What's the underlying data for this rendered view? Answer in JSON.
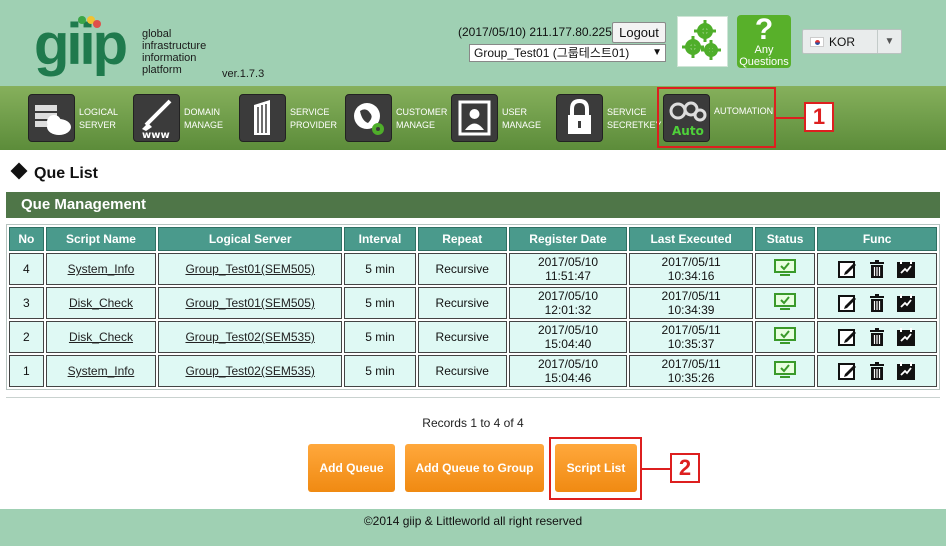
{
  "header": {
    "logo_text": "giip",
    "tagline": [
      "global",
      "infrastructure",
      "information",
      "platform"
    ],
    "version": "ver.1.7.3",
    "datetime_ip": "(2017/05/10) 211.177.80.225",
    "logout_label": "Logout",
    "group_selected": "Group_Test01 (그룹테스트01)",
    "any_questions": [
      "Any",
      "Questions"
    ],
    "language": "KOR"
  },
  "nav": [
    {
      "line1": "LOGICAL",
      "line2": "SERVER",
      "icon": "server-cloud-icon"
    },
    {
      "line1": "DOMAIN",
      "line2": "MANAGE",
      "icon": "www-brush-icon"
    },
    {
      "line1": "SERVICE",
      "line2": "PROVIDER",
      "icon": "building-icon"
    },
    {
      "line1": "CUSTOMER",
      "line2": "MANAGE",
      "icon": "globe-gear-icon"
    },
    {
      "line1": "USER",
      "line2": "MANAGE",
      "icon": "user-portrait-icon"
    },
    {
      "line1": "SERVICE",
      "line2": "SECRETKEY",
      "icon": "padlock-icon"
    },
    {
      "line1": "AUTOMATION",
      "line2": "",
      "icon": "auto-gears-icon"
    }
  ],
  "callouts": [
    "1",
    "2"
  ],
  "page": {
    "title": "Que List",
    "section": "Que Management"
  },
  "table": {
    "headers": [
      "No",
      "Script Name",
      "Logical Server",
      "Interval",
      "Repeat",
      "Register Date",
      "Last Executed",
      "Status",
      "Func"
    ],
    "rows": [
      {
        "no": "4",
        "script": "System_Info",
        "server": "Group_Test01(SEM505)",
        "interval": "5 min",
        "repeat": "Recursive",
        "reg_date": "2017/05/10",
        "reg_time": "11:51:47",
        "exec_date": "2017/05/11",
        "exec_time": "10:34:16"
      },
      {
        "no": "3",
        "script": "Disk_Check",
        "server": "Group_Test01(SEM505)",
        "interval": "5 min",
        "repeat": "Recursive",
        "reg_date": "2017/05/10",
        "reg_time": "12:01:32",
        "exec_date": "2017/05/11",
        "exec_time": "10:34:39"
      },
      {
        "no": "2",
        "script": "Disk_Check",
        "server": "Group_Test02(SEM535)",
        "interval": "5 min",
        "repeat": "Recursive",
        "reg_date": "2017/05/10",
        "reg_time": "15:04:40",
        "exec_date": "2017/05/11",
        "exec_time": "10:35:37"
      },
      {
        "no": "1",
        "script": "System_Info",
        "server": "Group_Test02(SEM535)",
        "interval": "5 min",
        "repeat": "Recursive",
        "reg_date": "2017/05/10",
        "reg_time": "15:04:46",
        "exec_date": "2017/05/11",
        "exec_time": "10:35:26"
      }
    ]
  },
  "records_text": "Records 1 to 4 of 4",
  "buttons": {
    "add_queue": "Add Queue",
    "add_queue_group": "Add Queue to Group",
    "script_list": "Script List"
  },
  "footer": "©2014 giip & Littleworld all right reserved",
  "colors": {
    "header_bg": "#9fd0b3",
    "nav_green": "#6f9e48",
    "section_bar": "#4f7648",
    "table_header": "#4a9a8c",
    "table_cell": "#dff9f4",
    "orange": "#f7941d",
    "callout_red": "#dd1f1f"
  }
}
